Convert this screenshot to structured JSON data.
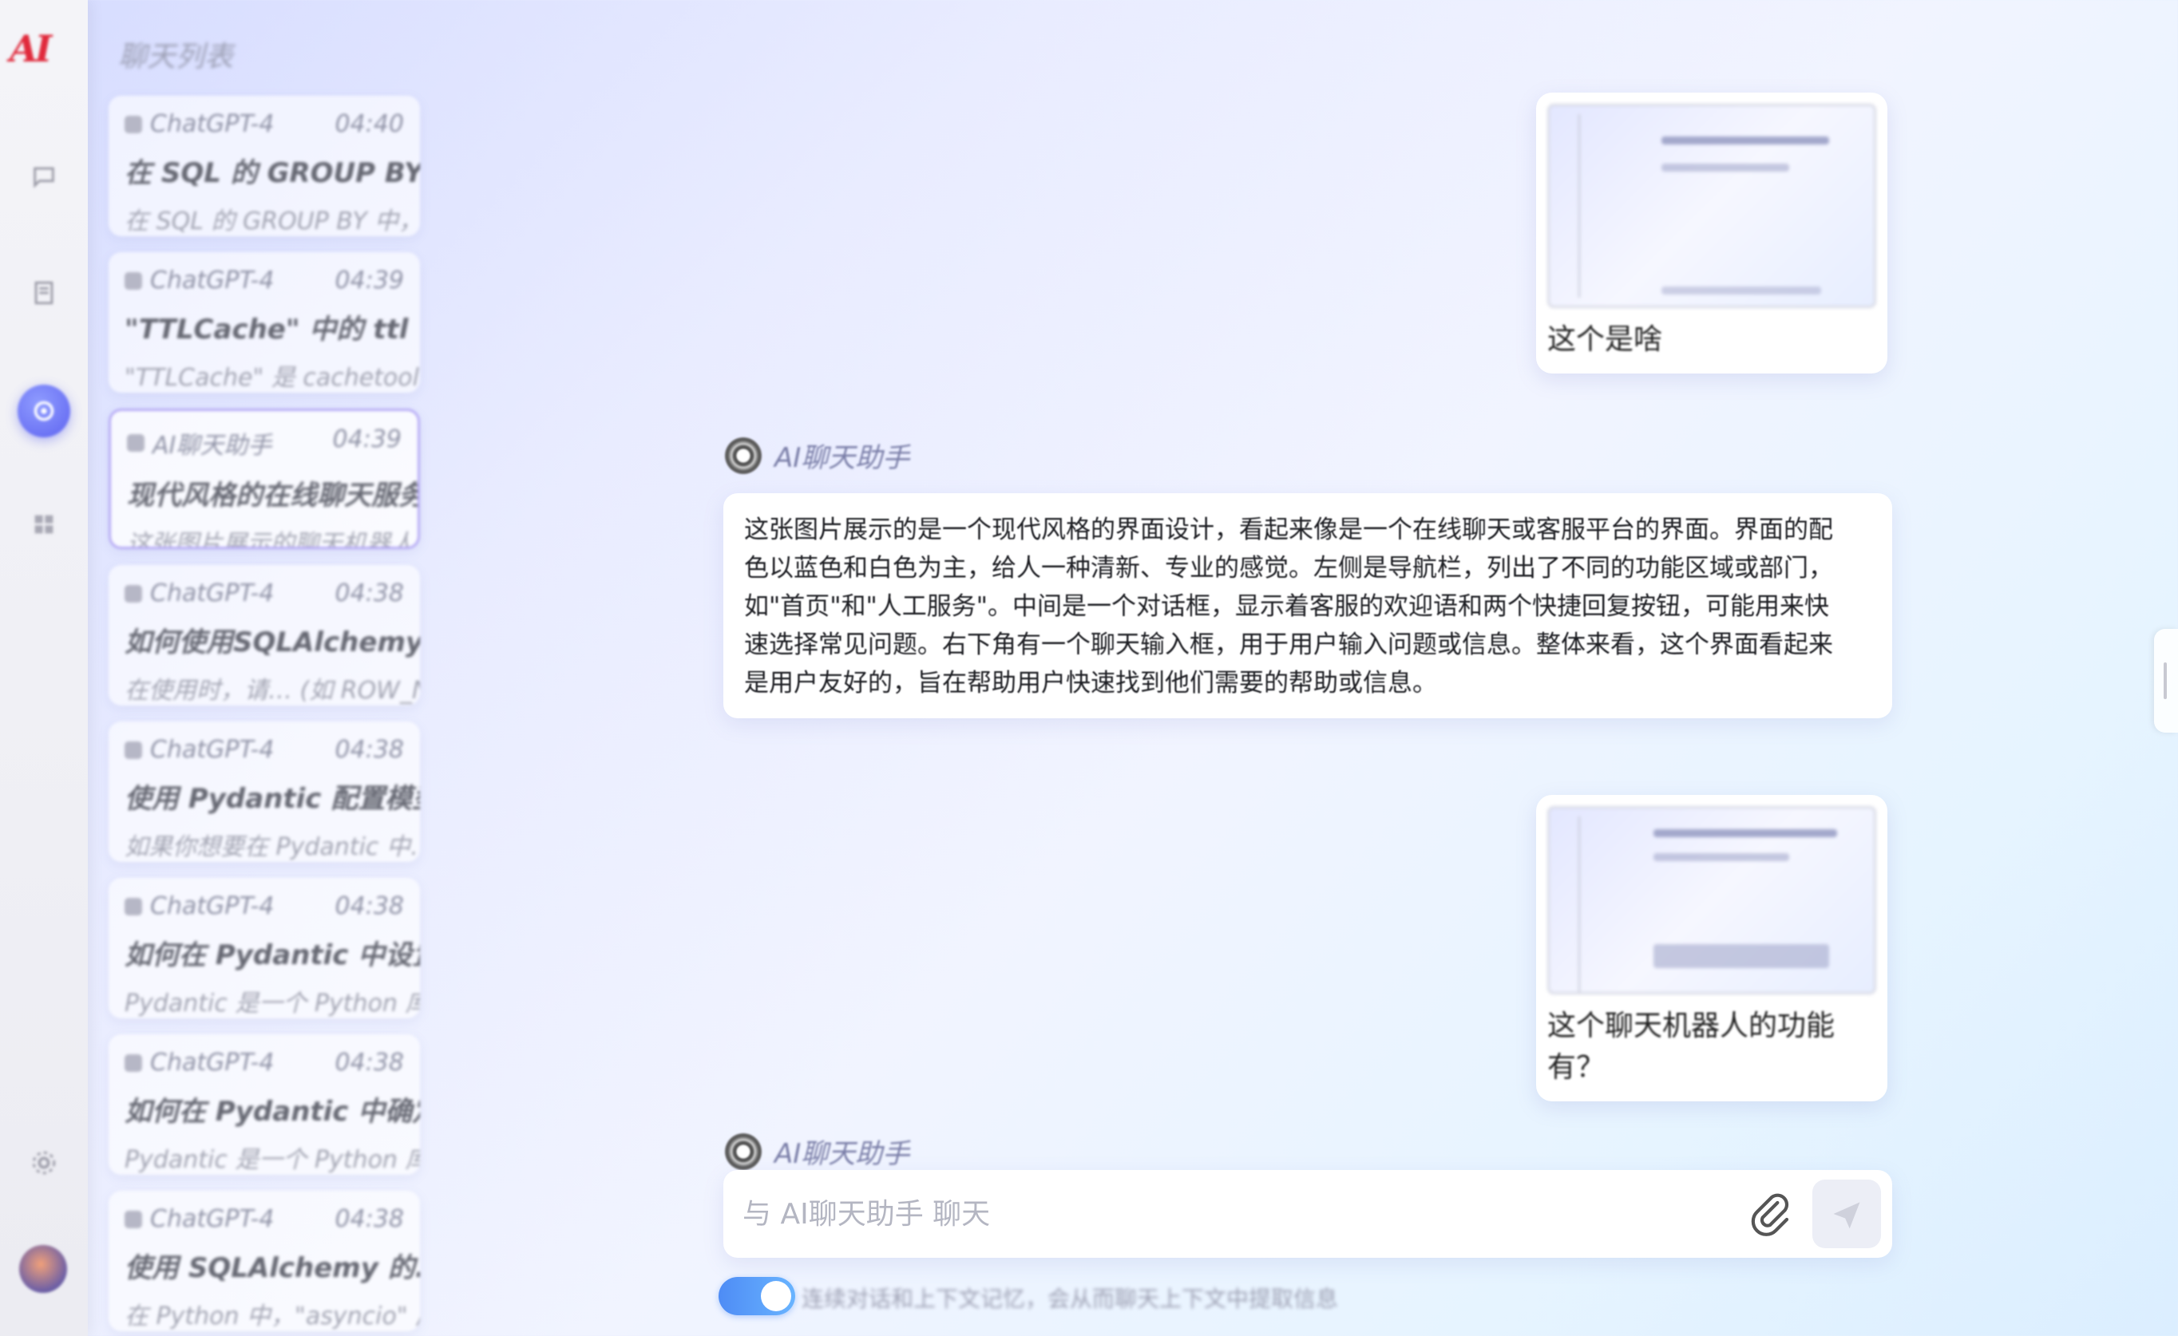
{
  "app": {
    "logo_text": "AI"
  },
  "rail": {
    "items": [
      {
        "icon": "chat-icon"
      },
      {
        "icon": "document-icon"
      },
      {
        "icon": "assistant-icon"
      },
      {
        "icon": "grid-icon"
      },
      {
        "icon": "settings-icon"
      }
    ]
  },
  "sidebar": {
    "title": "聊天列表",
    "conversations": [
      {
        "model": "ChatGPT-4",
        "time": "04:40",
        "line1": "在 SQL 的 GROUP BY 中，如果…",
        "line2": "在 SQL 的 GROUP BY 中，release 不…"
      },
      {
        "model": "ChatGPT-4",
        "time": "04:39",
        "line1": "\"TTLCache\" 中的 ttl 参数…",
        "line2": "\"TTLCache\" 是 cachetools 中的…"
      },
      {
        "model": "AI聊天助手",
        "time": "04:39",
        "line1": "现代风格的在线聊天服务…",
        "line2": "这张图片展示的聊天机器人界面…"
      },
      {
        "model": "ChatGPT-4",
        "time": "04:38",
        "line1": "如何使用SQLAlchemy中的…",
        "line2": "在使用时，请… (如 ROW_NU…"
      },
      {
        "model": "ChatGPT-4",
        "time": "04:38",
        "line1": "使用 Pydantic 配置模型…",
        "line2": "如果你想要在 Pydantic 中…"
      },
      {
        "model": "ChatGPT-4",
        "time": "04:38",
        "line1": "如何在 Pydantic 中设置默…",
        "line2": "Pydantic 是一个 Python 库…"
      },
      {
        "model": "ChatGPT-4",
        "time": "04:38",
        "line1": "如何在 Pydantic 中确定必…",
        "line2": "Pydantic 是一个 Python 库…"
      },
      {
        "model": "ChatGPT-4",
        "time": "04:38",
        "line1": "使用 SQLAlchemy 的…",
        "line2": "在 Python 中，\"asyncio\" 库…"
      }
    ]
  },
  "chat": {
    "messages": [
      {
        "role": "user",
        "type": "image",
        "caption": "这个是啥"
      },
      {
        "role": "assistant",
        "sender": "AI聊天助手",
        "lines": [
          "这张图片展示的是一个现代风格的界面设计，看起来像是一个在线聊天或客服平台的界面。界面的配",
          "色以蓝色和白色为主，给人一种清新、专业的感觉。左侧是导航栏，列出了不同的功能区域或部门，",
          "如\"首页\"和\"人工服务\"。中间是一个对话框，显示着客服的欢迎语和两个快捷回复按钮，可能用来快",
          "速选择常见问题。右下角有一个聊天输入框，用于用户输入问题或信息。整体来看，这个界面看起来",
          "是用户友好的，旨在帮助用户快速找到他们需要的帮助或信息。"
        ]
      },
      {
        "role": "user",
        "type": "image",
        "caption": "这个聊天机器人的功能有？"
      }
    ],
    "typing_sender": "AI聊天助手"
  },
  "composer": {
    "placeholder": "与 AI聊天助手 聊天",
    "attach_icon": "paperclip-icon",
    "send_icon": "send-icon",
    "toggle_on": true,
    "toggle_label": "连续对话和上下文记忆，会从而聊天上下文中提取信息"
  },
  "colors": {
    "accent": "#5e63f0",
    "toggle": "#4e8cf5",
    "logo": "#e02a3c"
  }
}
